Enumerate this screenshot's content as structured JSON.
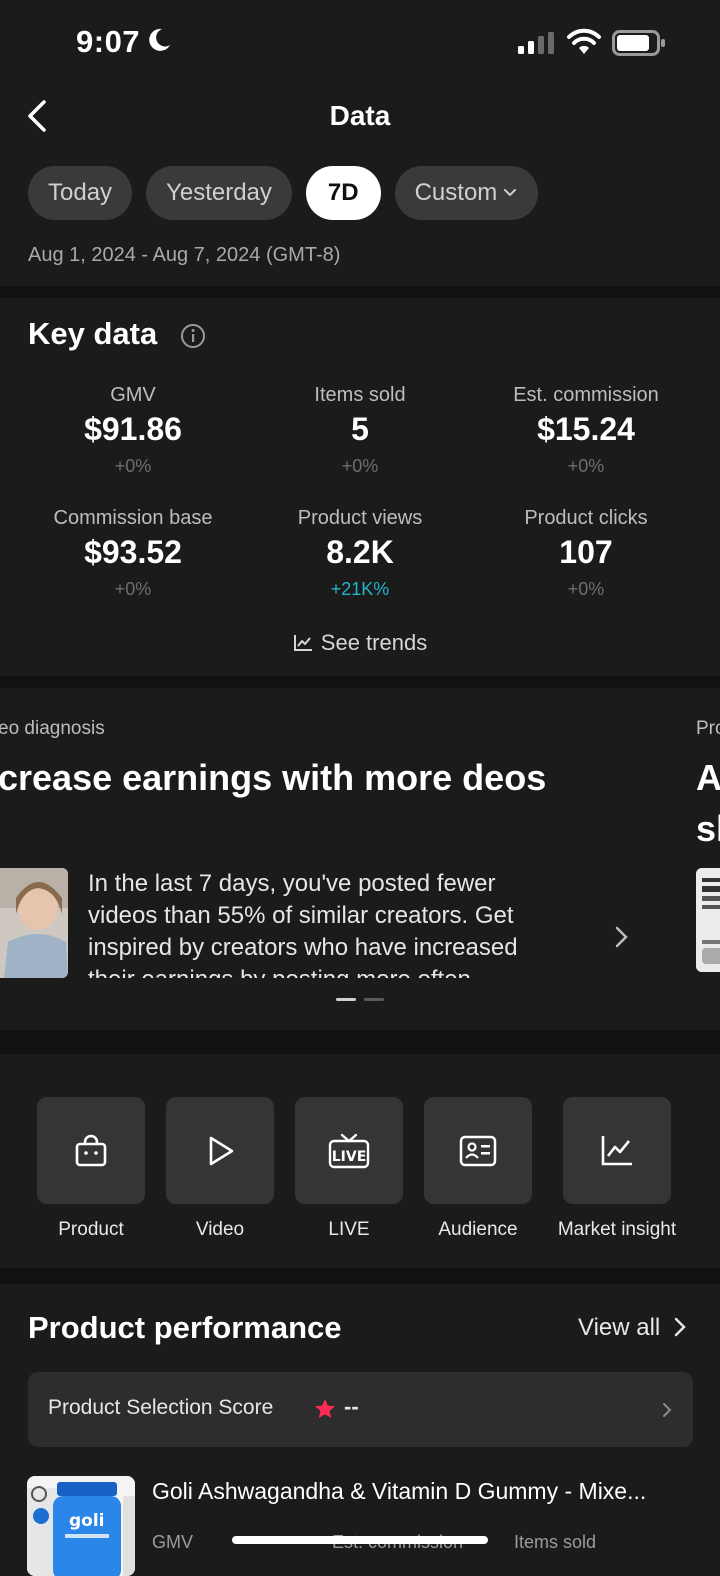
{
  "status_bar": {
    "time": "9:07"
  },
  "header": {
    "title": "Data"
  },
  "date_filters": [
    {
      "label": "Today",
      "active": false
    },
    {
      "label": "Yesterday",
      "active": false
    },
    {
      "label": "7D",
      "active": true
    },
    {
      "label": "Custom",
      "active": false
    }
  ],
  "date_range": "Aug 1, 2024 - Aug 7, 2024 (GMT-8)",
  "key_data": {
    "title": "Key data",
    "metrics": [
      {
        "label": "GMV",
        "value": "$91.86",
        "delta": "+0%"
      },
      {
        "label": "Items sold",
        "value": "5",
        "delta": "+0%"
      },
      {
        "label": "Est. commission",
        "value": "$15.24",
        "delta": "+0%"
      },
      {
        "label": "Commission base",
        "value": "$93.52",
        "delta": "+0%"
      },
      {
        "label": "Product views",
        "value": "8.2K",
        "delta": "+21K%"
      },
      {
        "label": "Product clicks",
        "value": "107",
        "delta": "+0%"
      }
    ],
    "see_trends": "See trends"
  },
  "carousel": {
    "card": {
      "label": "eo diagnosis",
      "title": "crease earnings with more deos",
      "description": "In the last 7 days, you've posted fewer videos than 55% of similar creators. Get inspired by creators who have increased their earnings by posting more often."
    },
    "peek": {
      "label": "Pro",
      "title_line1": "A",
      "title_line2": "sl"
    },
    "pages": 2,
    "active_page": 1
  },
  "tools": [
    {
      "label": "Product",
      "icon": "shopping-bag-icon"
    },
    {
      "label": "Video",
      "icon": "play-icon"
    },
    {
      "label": "LIVE",
      "icon": "live-tv-icon"
    },
    {
      "label": "Audience",
      "icon": "id-card-icon"
    },
    {
      "label": "Market insight",
      "icon": "chart-line-icon"
    }
  ],
  "product_performance": {
    "title": "Product performance",
    "view_all": "View all",
    "score_label": "Product Selection Score",
    "score_value": "--",
    "product": {
      "name": "Goli Ashwagandha & Vitamin D Gummy - Mixe...",
      "columns": [
        "GMV",
        "Est. commission",
        "Items sold"
      ]
    }
  },
  "colors": {
    "accent": "#22b5cc",
    "star": "#fe2c55",
    "background": "#1b1b1b"
  }
}
